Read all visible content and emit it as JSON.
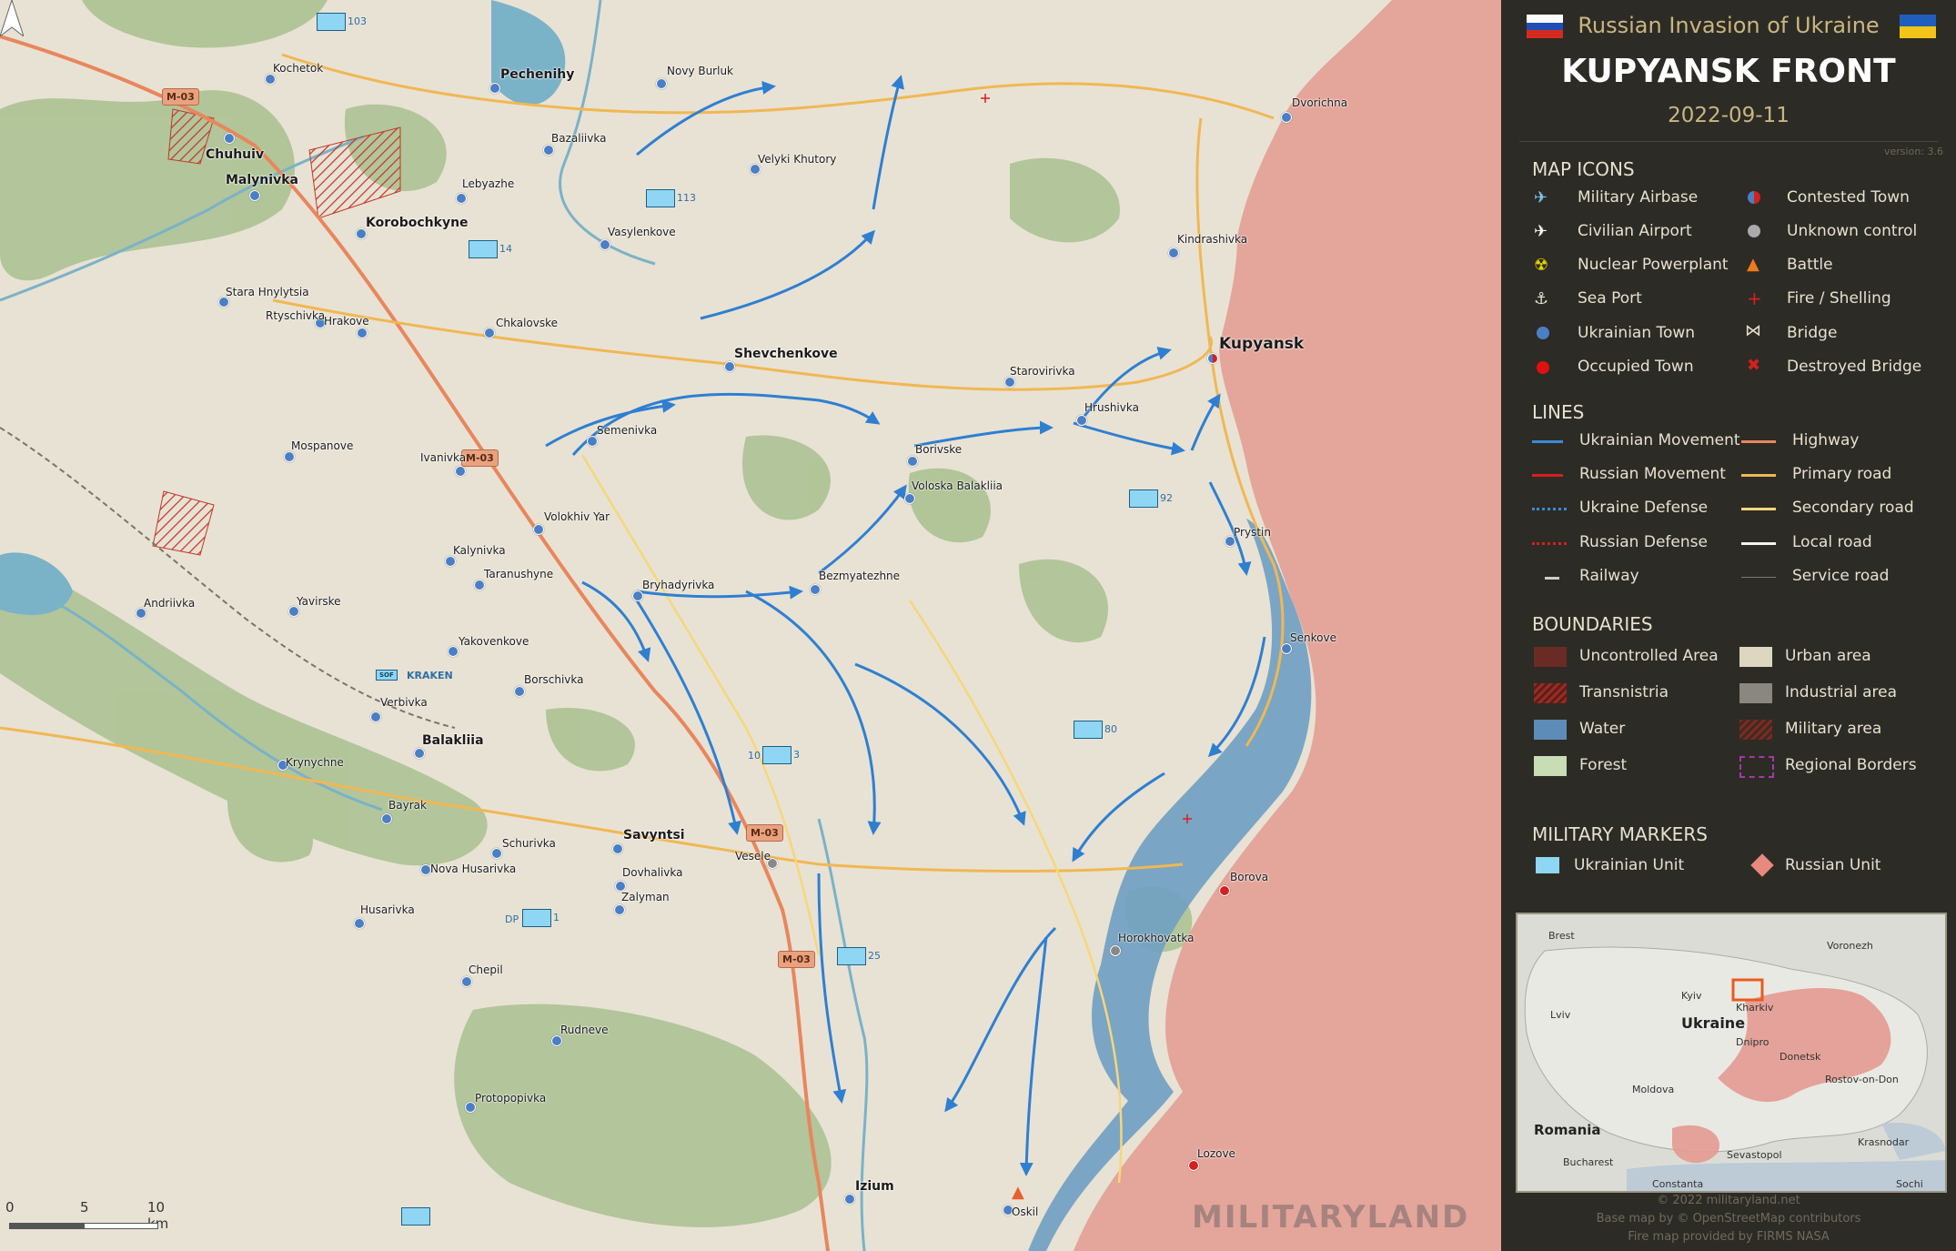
{
  "header": {
    "subtitle": "Russian Invasion of Ukraine",
    "title": "KUPYANSK FRONT",
    "date": "2022-09-11",
    "version": "version: 3.6"
  },
  "legend": {
    "map_icons_title": "MAP ICONS",
    "map_icons": [
      {
        "label": "Military Airbase",
        "icon": "military-airbase-icon"
      },
      {
        "label": "Contested Town",
        "icon": "contested-town-icon"
      },
      {
        "label": "Civilian Airport",
        "icon": "civilian-airport-icon"
      },
      {
        "label": "Unknown control",
        "icon": "unknown-control-icon"
      },
      {
        "label": "Nuclear Powerplant",
        "icon": "nuclear-powerplant-icon"
      },
      {
        "label": "Battle",
        "icon": "battle-icon"
      },
      {
        "label": "Sea Port",
        "icon": "sea-port-icon"
      },
      {
        "label": "Fire / Shelling",
        "icon": "fire-shelling-icon"
      },
      {
        "label": "Ukrainian Town",
        "icon": "ukrainian-town-icon"
      },
      {
        "label": "Bridge",
        "icon": "bridge-icon"
      },
      {
        "label": "Occupied Town",
        "icon": "occupied-town-icon"
      },
      {
        "label": "Destroyed Bridge",
        "icon": "destroyed-bridge-icon"
      }
    ],
    "lines_title": "LINES",
    "lines": [
      {
        "label": "Ukrainian Movement"
      },
      {
        "label": "Highway"
      },
      {
        "label": "Russian Movement"
      },
      {
        "label": "Primary road"
      },
      {
        "label": "Ukraine Defense"
      },
      {
        "label": "Secondary road"
      },
      {
        "label": "Russian Defense"
      },
      {
        "label": "Local road"
      },
      {
        "label": "Railway"
      },
      {
        "label": "Service road"
      }
    ],
    "boundaries_title": "BOUNDARIES",
    "boundaries": [
      {
        "label": "Uncontrolled Area"
      },
      {
        "label": "Urban area"
      },
      {
        "label": "Transnistria"
      },
      {
        "label": "Industrial area"
      },
      {
        "label": "Water"
      },
      {
        "label": "Military area"
      },
      {
        "label": "Forest"
      },
      {
        "label": "Regional Borders"
      }
    ],
    "markers_title": "MILITARY MARKERS",
    "markers": [
      {
        "label": "Ukrainian Unit"
      },
      {
        "label": "Russian Unit"
      }
    ],
    "colors": {
      "ukraine_blue": "#4b7fc4",
      "russia_red": "#d42020",
      "occupied_area": "#e39a91",
      "background": "#2d2b25",
      "accent_gold": "#c9b681"
    }
  },
  "inset": {
    "labels": [
      "Brest",
      "Voronezh",
      "Kyiv",
      "Kharkiv",
      "Lviv",
      "Ukraine",
      "Dnipro",
      "Donetsk",
      "Rostov-on-Don",
      "Moldova",
      "Romania",
      "Krasnodar",
      "Bucharest",
      "Sevastopol",
      "Constanta",
      "Sochi"
    ]
  },
  "credits": {
    "line1": "© 2022 militaryland.net",
    "line2": "Base map by © OpenStreetMap contributors",
    "line3": "Fire map provided by FIRMS NASA"
  },
  "map": {
    "towns": [
      "Kochetok",
      "Pechenihy",
      "Novy Burluk",
      "Dvorichna",
      "Chuhuiv",
      "Malynivka",
      "Bazaliivka",
      "Velyki Khutory",
      "Lebyazhe",
      "Korobochkyne",
      "Vasylenkove",
      "Kindrashivka",
      "Stara Hnylytsia",
      "Rtyschivka",
      "Hrakove",
      "Chkalovske",
      "Kupyansk",
      "Shevchenkove",
      "Starovirivka",
      "Hrushivka",
      "Semenivka",
      "Mospanove",
      "Ivanivka",
      "Borivske",
      "Voloska Balakliia",
      "Volokhiv Yar",
      "Kalynivka",
      "Prystin",
      "Taranushyne",
      "Bryhadyrivka",
      "Bezmyatezhne",
      "Andriivka",
      "Yavirske",
      "Senkove",
      "Yakovenkove",
      "Borschivka",
      "Verbivka",
      "Balakliia",
      "Krynychne",
      "Bayrak",
      "Savyntsi",
      "Vesele",
      "Schurivka",
      "Dovhalivka",
      "Borova",
      "Nova Husarivka",
      "Zalyman",
      "Husarivka",
      "Horokhovatka",
      "Chepil",
      "Rudneve",
      "Protopopivka",
      "Lozove",
      "Izium",
      "Oskil"
    ],
    "road_badges": [
      "M-03",
      "M-03",
      "M-03",
      "M-03"
    ],
    "units": [
      "103",
      "113",
      "14",
      "92",
      "80",
      "3",
      "25",
      "1"
    ],
    "unit_prefixes": [
      "10",
      "DP"
    ],
    "sof_label": "KRAKEN",
    "scale": {
      "zero": "0",
      "five": "5",
      "ten": "10 km"
    },
    "watermark": "MILITARYLAND"
  }
}
